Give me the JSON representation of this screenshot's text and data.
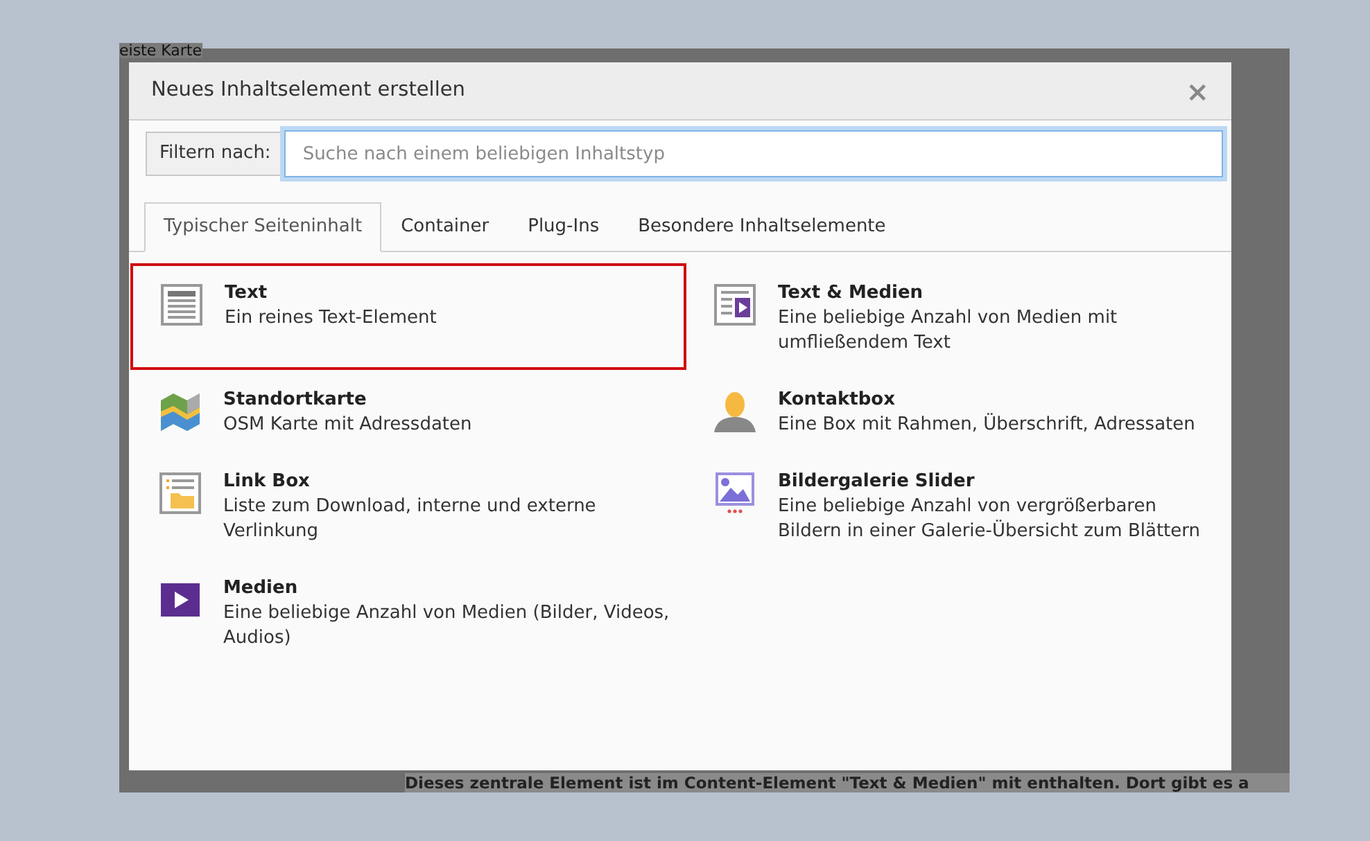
{
  "background": {
    "top_text": "eiste  Karte",
    "bottom_text": "Dieses zentrale Element ist im Content-Element \"Text & Medien\" mit enthalten. Dort gibt es a"
  },
  "dialog": {
    "title": "Neues Inhaltselement erstellen",
    "close": "×"
  },
  "filter": {
    "label": "Filtern nach:",
    "placeholder": "Suche nach einem beliebigen Inhaltstyp"
  },
  "tabs": [
    {
      "label": "Typischer Seiteninhalt",
      "selected": true
    },
    {
      "label": "Container",
      "selected": false
    },
    {
      "label": "Plug-Ins",
      "selected": false
    },
    {
      "label": "Besondere Inhaltselemente",
      "selected": false
    }
  ],
  "items": [
    {
      "kind": "text",
      "title": "Text",
      "description": "Ein reines Text-Element",
      "selected": true
    },
    {
      "kind": "textmedia",
      "title": "Text & Medien",
      "description": "Eine beliebige Anzahl von Medien mit umfließendem Text",
      "selected": false
    },
    {
      "kind": "map",
      "title": "Standortkarte",
      "description": "OSM Karte mit Adressdaten",
      "selected": false
    },
    {
      "kind": "contact",
      "title": "Kontaktbox",
      "description": "Eine Box mit Rahmen, Überschrift, Adressaten",
      "selected": false
    },
    {
      "kind": "linkbox",
      "title": "Link Box",
      "description": "Liste zum Download, interne und externe Verlinkung",
      "selected": false
    },
    {
      "kind": "gallery",
      "title": "Bildergalerie Slider",
      "description": "Eine beliebige Anzahl von vergrößerbaren Bildern in einer Galerie-Übersicht zum Blättern",
      "selected": false
    },
    {
      "kind": "media",
      "title": "Medien",
      "description": "Eine beliebige Anzahl von Medien (Bilder, Videos, Audios)",
      "selected": false
    }
  ]
}
